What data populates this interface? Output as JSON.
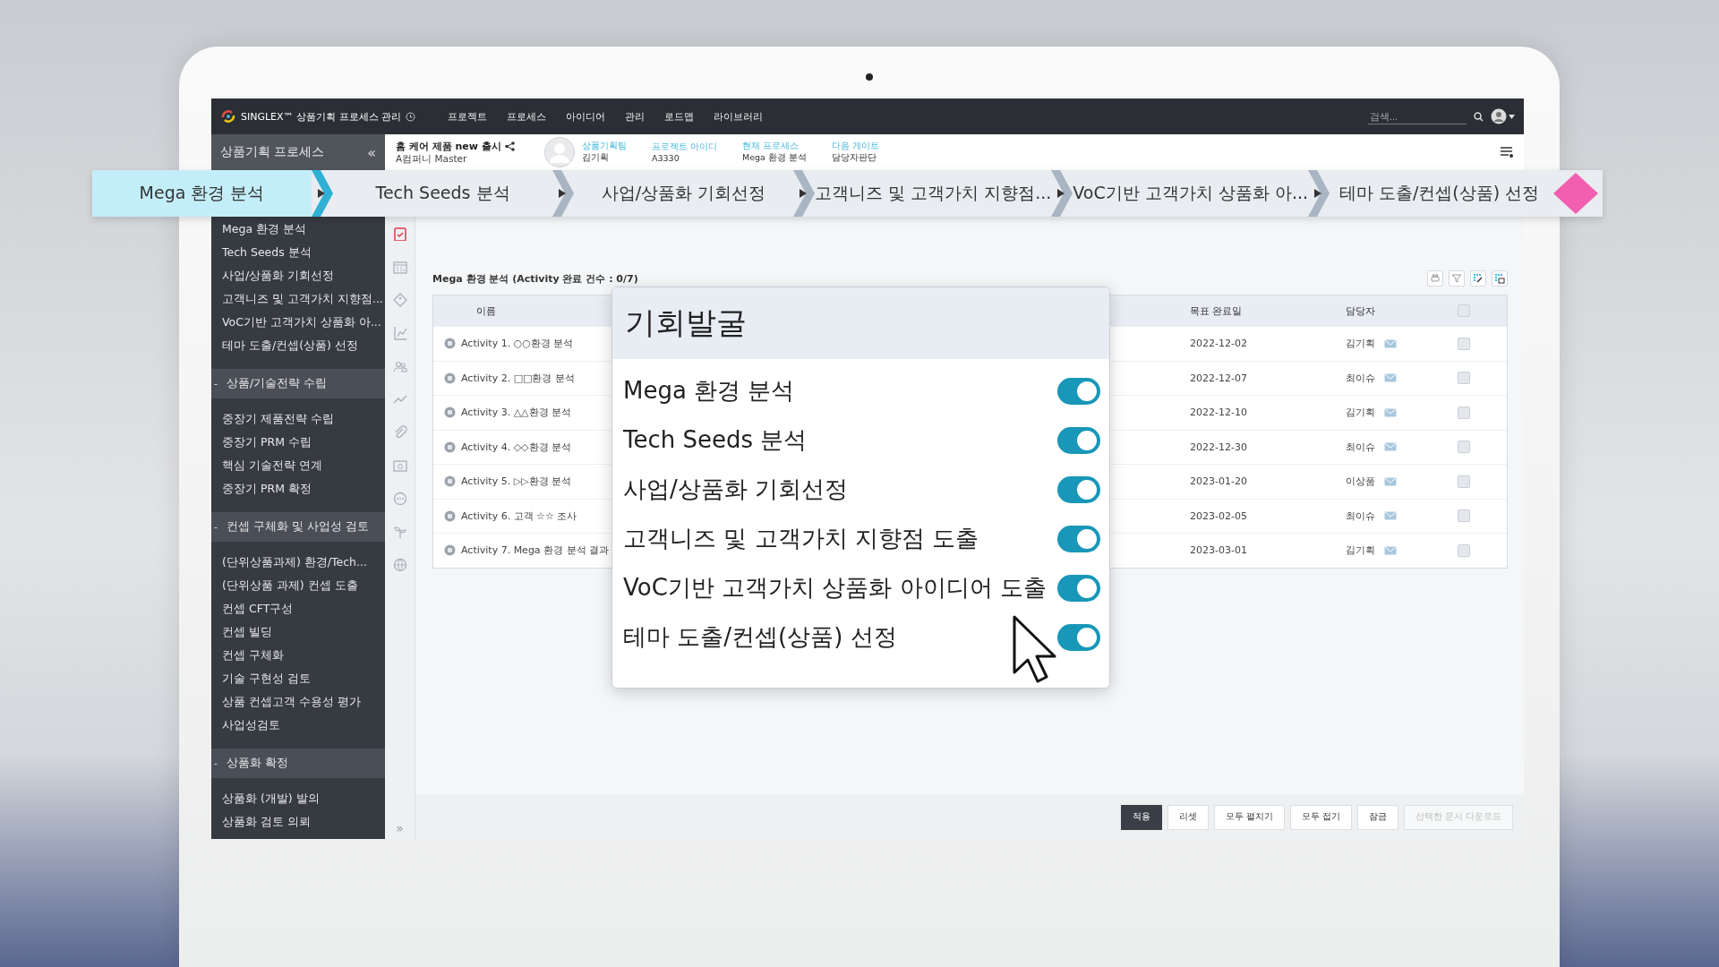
{
  "app": {
    "title": "SINGLEX™ 상품기획 프로세스 관리",
    "menu": [
      "프로젝트",
      "프로세스",
      "아이디어",
      "관리",
      "로드맵",
      "라이브러리"
    ],
    "search": {
      "placeholder": "검색..."
    }
  },
  "sidebar": {
    "title": "상품기획 프로세스",
    "collapse": "«",
    "groups": [
      {
        "items": [
          "Mega 환경 분석",
          "Tech Seeds 분석",
          "사업/상품화 기회선정",
          "고객니즈 및 고객가치 지향점...",
          "VoC기반 고객가치 상품화 아...",
          "테마 도출/컨셉(상품) 선정"
        ]
      },
      {
        "toggle": "-",
        "title": "상품/기술전략 수립",
        "items": [
          "중장기 제품전략 수립",
          "중장기 PRM 수립",
          "핵심 기술전략 연계",
          "중장기 PRM 확정"
        ]
      },
      {
        "toggle": "-",
        "title": "컨셉 구체화 및 사업성 검토",
        "items": [
          "(단위상품과제) 환경/Tech...",
          "(단위상품 과제) 컨셉 도출",
          "컨셉 CFT구성",
          "컨셉 빌딩",
          "컨셉 구체화",
          "기술 구현성 검토",
          "상품 컨셉고객 수용성 평가",
          "사업성검토"
        ]
      },
      {
        "toggle": "-",
        "title": "상품화 확정",
        "items": [
          "상품화 (개발) 발의",
          "상품화 검토 의뢰"
        ]
      }
    ]
  },
  "project": {
    "title": "홈 케어 제품 new 출시",
    "subtitle": "A컴퍼니 Master",
    "fields": [
      {
        "label": "상품기획팀",
        "value": "김기획"
      },
      {
        "label": "프로젝트 아이디",
        "value": "A3330"
      },
      {
        "label": "현재 프로세스",
        "value": "Mega 환경 분석"
      },
      {
        "label": "다음 게이트",
        "value": "담당자판단"
      }
    ]
  },
  "steps": [
    {
      "label": "Mega 환경 분석",
      "selected": true
    },
    {
      "label": "Tech Seeds 분석",
      "selected": false
    },
    {
      "label": "사업/상품화 기회선정",
      "selected": false
    },
    {
      "label": "고객니즈 및 고객가치 지향점...",
      "selected": false
    },
    {
      "label": "VoC기반 고객가치 상품화 아...",
      "selected": false
    },
    {
      "label": "테마 도출/컨셉(상품) 선정",
      "selected": false
    }
  ],
  "tools": [
    {
      "kind": "clipboard",
      "selected": true
    },
    {
      "kind": "calendar",
      "selected": false
    },
    {
      "kind": "tag",
      "selected": false
    },
    {
      "kind": "chart",
      "selected": false
    },
    {
      "kind": "users",
      "selected": false
    },
    {
      "kind": "trend",
      "selected": false
    },
    {
      "kind": "clip",
      "selected": false
    },
    {
      "kind": "folder",
      "selected": false
    },
    {
      "kind": "chat",
      "selected": false
    },
    {
      "kind": "sprout",
      "selected": false
    },
    {
      "kind": "globe",
      "selected": false
    }
  ],
  "tools_expand": "»",
  "section": {
    "title": "Mega 환경 분석 (Activity 완료 건수 : 0/7)",
    "actions": [
      {
        "kind": "print"
      },
      {
        "kind": "filter"
      },
      {
        "kind": "edit"
      },
      {
        "kind": "grid"
      }
    ]
  },
  "table": {
    "columns": [
      "이름",
      "목표 완료일",
      "담당자"
    ],
    "header_checked": false,
    "rows": [
      {
        "name": "Activity 1. ○○환경 분석",
        "date": "2022-12-02",
        "owner": "김기획",
        "checked": false
      },
      {
        "name": "Activity 2. □□환경 분석",
        "date": "2022-12-07",
        "owner": "최이슈",
        "checked": false
      },
      {
        "name": "Activity 3. △△환경 분석",
        "date": "2022-12-10",
        "owner": "김기획",
        "checked": false
      },
      {
        "name": "Activity 4. ◇◇환경 분석",
        "date": "2022-12-30",
        "owner": "최이슈",
        "checked": false
      },
      {
        "name": "Activity 5. ▷▷환경 분석",
        "date": "2023-01-20",
        "owner": "이상품",
        "checked": false
      },
      {
        "name": "Activity 6. 고객 ☆☆ 조사",
        "date": "2023-02-05",
        "owner": "최이슈",
        "checked": false
      },
      {
        "name": "Activity 7. Mega 환경 분석 결과",
        "date": "2023-03-01",
        "owner": "김기획",
        "checked": false
      }
    ]
  },
  "buttons": [
    {
      "label": "적용",
      "kind": "primary"
    },
    {
      "label": "리셋",
      "kind": "default"
    },
    {
      "label": "모두 펼치기",
      "kind": "default"
    },
    {
      "label": "모두 접기",
      "kind": "default"
    },
    {
      "label": "잠금",
      "kind": "default"
    },
    {
      "label": "선택한 문서 다운로드",
      "kind": "disabled"
    }
  ],
  "popup": {
    "title": "기회발굴",
    "items": [
      {
        "label": "Mega 환경 분석",
        "on": true
      },
      {
        "label": "Tech Seeds 분석",
        "on": true
      },
      {
        "label": "사업/상품화 기회선정",
        "on": true
      },
      {
        "label": "고객니즈 및 고객가치 지향점 도출",
        "on": true
      },
      {
        "label": "VoC기반 고객가치 상품화 아이디어 도출",
        "on": true
      },
      {
        "label": "테마 도출/컨셉(상품) 선정",
        "on": true
      }
    ]
  }
}
